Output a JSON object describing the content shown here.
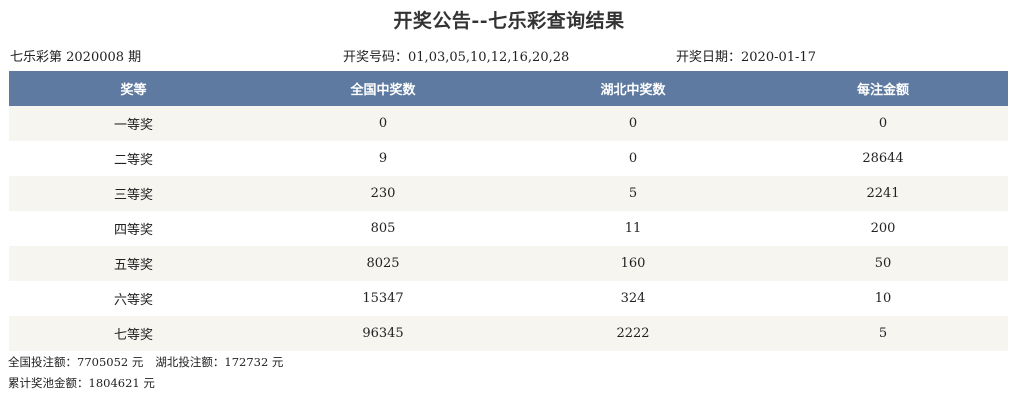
{
  "title": "开奖公告--七乐彩查询结果",
  "info": {
    "issue": "七乐彩第 2020008 期",
    "numbers_label": "开奖号码：",
    "numbers": "01,03,05,10,12,16,20,28",
    "date_label": "开奖日期：",
    "date": "2020-01-17"
  },
  "table": {
    "headers": [
      "奖等",
      "全国中奖数",
      "湖北中奖数",
      "每注金额"
    ],
    "rows": [
      [
        "一等奖",
        "0",
        "0",
        "0"
      ],
      [
        "二等奖",
        "9",
        "0",
        "28644"
      ],
      [
        "三等奖",
        "230",
        "5",
        "2241"
      ],
      [
        "四等奖",
        "805",
        "11",
        "200"
      ],
      [
        "五等奖",
        "8025",
        "160",
        "50"
      ],
      [
        "六等奖",
        "15347",
        "324",
        "10"
      ],
      [
        "七等奖",
        "96345",
        "2222",
        "5"
      ]
    ]
  },
  "footer": {
    "national_bet_label": "全国投注额：",
    "national_bet_value": "7705052 元",
    "hubei_bet_label": "湖北投注额：",
    "hubei_bet_value": "172732 元",
    "pool_label": "累计奖池金额：",
    "pool_value": "1804621 元"
  },
  "colors": {
    "header_bg": "#5e7aa1",
    "row_alt_bg": "#f6f5f0"
  }
}
